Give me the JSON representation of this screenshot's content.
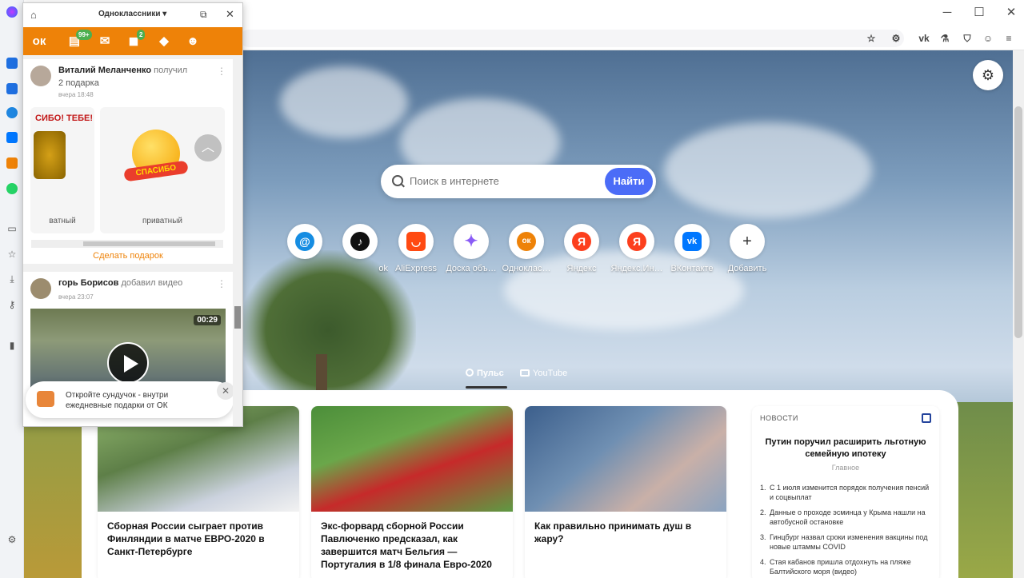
{
  "ok_panel": {
    "title": "Одноклассники",
    "badges": {
      "feed": "99+",
      "messages": "2"
    },
    "post1": {
      "name": "Виталий Меланченко",
      "action": "получил",
      "line2": "2 подарка",
      "time": "вчера 18:48",
      "gift1_text": "СИБО! ТЕБЕ!",
      "gift1_caption": "ватный",
      "gift2_band": "СПАСИБО",
      "gift2_caption": "приватный",
      "gift_link": "Сделать подарок"
    },
    "post2": {
      "name": "горь Борисов",
      "action": "добавил видео",
      "time": "вчера 23:07",
      "duration": "00:29"
    },
    "toast_text": "Откройте сундучок - внутри ежедневные подарки от ОК"
  },
  "search": {
    "placeholder": "Поиск в интернете",
    "button": "Найти"
  },
  "tiles": [
    {
      "label": "",
      "icon": "@",
      "color": "#168de2"
    },
    {
      "label": "ok",
      "icon": "♪",
      "color": "#111111"
    },
    {
      "label": "AliExpress",
      "icon": "◡",
      "color": "#ff4a12"
    },
    {
      "label": "Доска объ…",
      "icon": "✦",
      "color": "#8a5cf6"
    },
    {
      "label": "Одноклас…",
      "icon": "ок",
      "color": "#ee8208"
    },
    {
      "label": "Яндекс",
      "icon": "Я",
      "color": "#fc3f1d"
    },
    {
      "label": "Яндекс.Ин…",
      "icon": "Я",
      "color": "#fc3f1d"
    },
    {
      "label": "ВКонтакте",
      "icon": "vk",
      "color": "#0077ff"
    },
    {
      "label": "Добавить",
      "icon": "+",
      "color": "#ffffff"
    }
  ],
  "feed_tabs": {
    "pulse": "Пульс",
    "youtube": "YouTube"
  },
  "cards": [
    {
      "title": "Сборная России сыграет против Финляндии в матче ЕВРО-2020 в Санкт-Петербурге"
    },
    {
      "title": "Экс-форвард сборной России Павлюченко предсказал, как завершится матч Бельгия — Португалия в 1/8 финала Евро-2020"
    },
    {
      "title": "Как правильно принимать душ в жару?"
    }
  ],
  "news": {
    "header": "НОВОСТИ",
    "main": "Путин поручил расширить льготную семейную ипотеку",
    "main_sub": "Главное",
    "items": [
      "С 1 июля изменится порядок получения пенсий и соцвыплат",
      "Данные о проходе эсминца у Крыма нашли на автобусной остановке",
      "Гинцбург назвал сроки изменения вакцины под новые штаммы COVID",
      "Стая кабанов пришла отдохнуть на пляже Балтийского моря (видео)"
    ]
  },
  "colors": {
    "ok_orange": "#ee8208",
    "search_button": "#4b6cf7"
  }
}
